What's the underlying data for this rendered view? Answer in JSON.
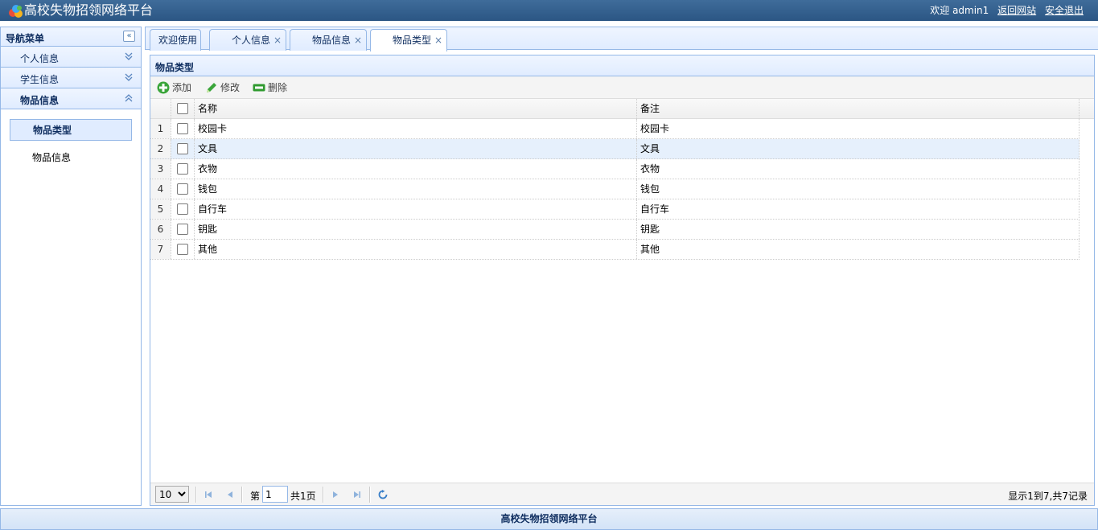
{
  "header": {
    "title": "高校失物招领网络平台",
    "welcome": "欢迎 admin1",
    "back_link": "返回网站",
    "logout_link": "安全退出"
  },
  "west": {
    "title": "导航菜单",
    "collapse_icon": "double-chevron-left-icon",
    "sections": [
      {
        "label": "个人信息",
        "state": "collapsed"
      },
      {
        "label": "学生信息",
        "state": "collapsed"
      },
      {
        "label": "物品信息",
        "state": "expanded"
      }
    ],
    "sub_items": [
      {
        "label": "物品类型",
        "active": true
      },
      {
        "label": "物品信息",
        "active": false
      }
    ]
  },
  "tabs": [
    {
      "label": "欢迎使用",
      "closable": false
    },
    {
      "label": "个人信息",
      "closable": true
    },
    {
      "label": "物品信息",
      "closable": true
    },
    {
      "label": "物品类型",
      "closable": true,
      "active": true
    }
  ],
  "tab_close_glyph": "×",
  "panel": {
    "title": "物品类型",
    "toolbar": {
      "add": "添加",
      "edit": "修改",
      "delete": "删除"
    },
    "columns": {
      "name": "名称",
      "remark": "备注"
    },
    "rows": [
      {
        "num": "1",
        "name": "校园卡",
        "remark": "校园卡"
      },
      {
        "num": "2",
        "name": "文具",
        "remark": "文具"
      },
      {
        "num": "3",
        "name": "衣物",
        "remark": "衣物"
      },
      {
        "num": "4",
        "name": "钱包",
        "remark": "钱包"
      },
      {
        "num": "5",
        "name": "自行车",
        "remark": "自行车"
      },
      {
        "num": "6",
        "name": "钥匙",
        "remark": "钥匙"
      },
      {
        "num": "7",
        "name": "其他",
        "remark": "其他"
      }
    ],
    "pager": {
      "page_size": "10",
      "page_prefix": "第",
      "page_value": "1",
      "page_total": "共1页",
      "info": "显示1到7,共7记录"
    }
  },
  "footer": {
    "text": "高校失物招领网络平台"
  },
  "colors": {
    "header": "#2b5684",
    "border": "#95b8e7",
    "panel_header": "#e0ecff"
  }
}
